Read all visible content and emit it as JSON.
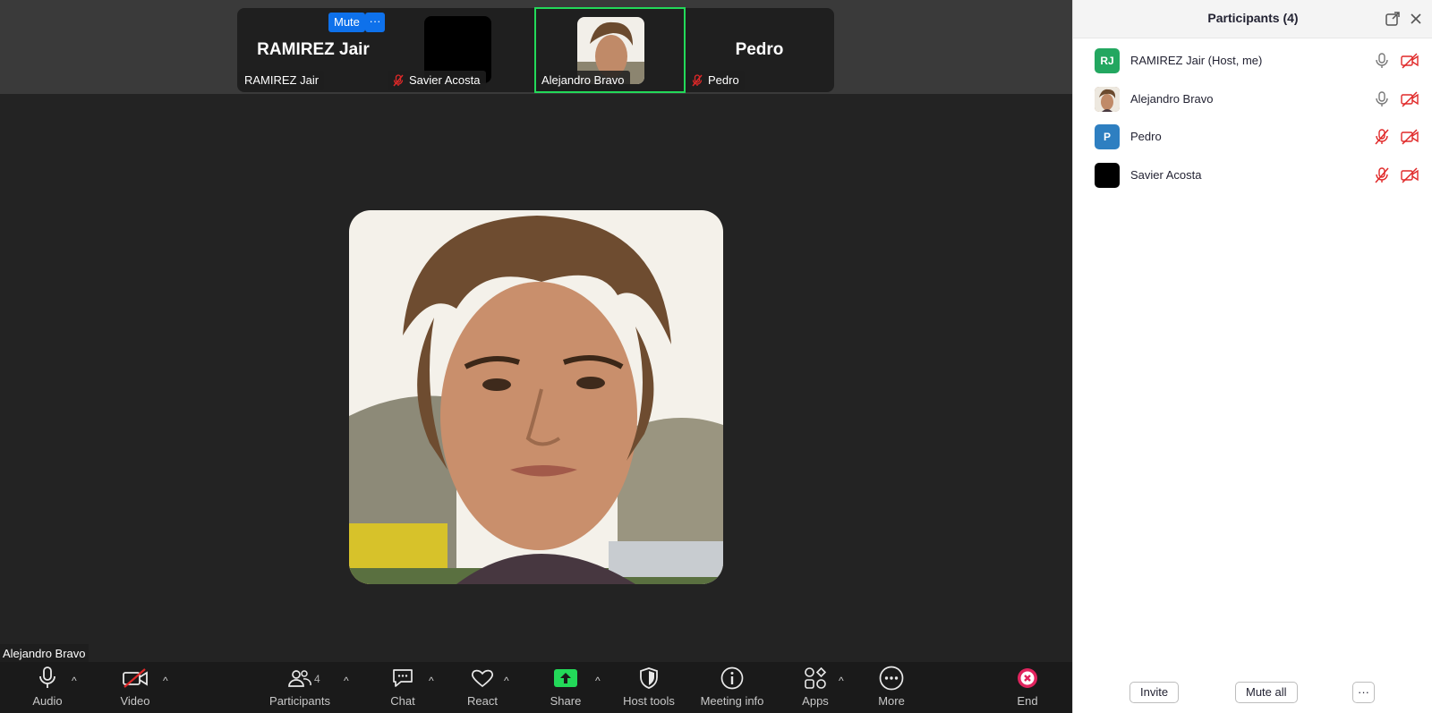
{
  "gallery": {
    "tile1": {
      "big_name": "RAMIREZ Jair",
      "name_tag": "RAMIREZ Jair",
      "mute_label": "Mute",
      "more_label": "···"
    },
    "tile2": {
      "name_tag": "Savier Acosta"
    },
    "tile3": {
      "name_tag": "Alejandro Bravo"
    },
    "tile4": {
      "big_name": "Pedro",
      "name_tag": "Pedro"
    }
  },
  "main_video": {
    "name_tag": "Alejandro Bravo"
  },
  "toolbar": {
    "audio": "Audio",
    "video": "Video",
    "participants": "Participants",
    "participants_count": "4",
    "chat": "Chat",
    "react": "React",
    "share": "Share",
    "host_tools": "Host tools",
    "meeting_info": "Meeting info",
    "apps": "Apps",
    "more": "More",
    "end": "End"
  },
  "panel": {
    "title": "Participants (4)",
    "participants": [
      {
        "initials": "RJ",
        "name": "RAMIREZ Jair (Host, me)",
        "avatar_color": "#23a760",
        "mic_muted": false,
        "video_off": true
      },
      {
        "initials": "",
        "name": "Alejandro Bravo",
        "avatar_color": "#a07858",
        "mic_muted": false,
        "video_off": true
      },
      {
        "initials": "P",
        "name": "Pedro",
        "avatar_color": "#2e7fc1",
        "mic_muted": true,
        "video_off": true
      },
      {
        "initials": "",
        "name": "Savier Acosta",
        "avatar_color": "#000000",
        "mic_muted": true,
        "video_off": true
      }
    ],
    "invite_label": "Invite",
    "mute_all_label": "Mute all",
    "more_label": "···"
  },
  "colors": {
    "active_speaker_border": "#23d959",
    "accent_blue": "#0e71eb",
    "share_green": "#23d959",
    "end_red": "#e0245e",
    "muted_red": "#e02828"
  }
}
